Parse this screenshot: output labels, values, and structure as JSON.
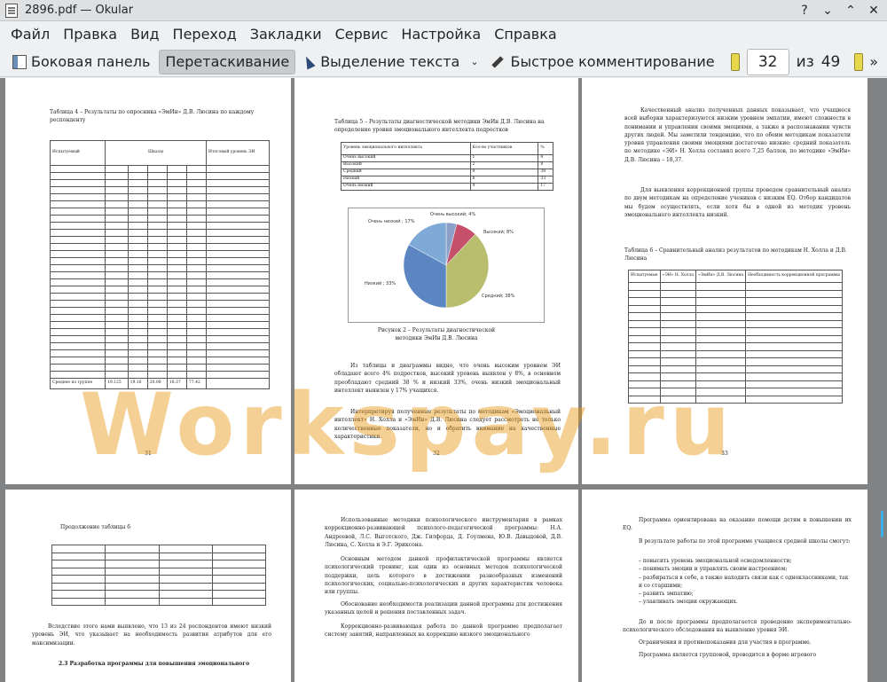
{
  "window": {
    "title": "2896.pdf — Okular"
  },
  "menu": [
    "Файл",
    "Правка",
    "Вид",
    "Переход",
    "Закладки",
    "Сервис",
    "Настройка",
    "Справка"
  ],
  "toolbar": {
    "sidebar": "Боковая панель",
    "drag": "Перетаскивание",
    "select_text": "Выделение текста",
    "quick_comment": "Быстрое комментирование",
    "page_current": "32",
    "of_label": "из",
    "page_total": "49"
  },
  "watermark": "Workspay.ru",
  "pages": {
    "p31": {
      "caption": "Таблица 4 – Результаты по опросника «ЭмИн» Д.В. Люсина по каждому респонденту",
      "header": [
        "Испытуемый",
        "Шкалы",
        "Итоговый уровень ЭИ"
      ],
      "avg_label": "Среднее по группе",
      "avg_values": [
        "19.125",
        "19.16",
        "20.08",
        "18.37",
        "77.42"
      ],
      "num": "31"
    },
    "p32": {
      "caption": "Таблица 5 – Результаты диагностической методики ЭмИн Д.В. Люсина на определение уровня эмоционального интеллекта подростков",
      "col_headers": [
        "Уровень эмоционального интеллекта",
        "Кол-во участников",
        "%"
      ],
      "rows": [
        [
          "Очень высокий",
          "1",
          "4"
        ],
        [
          "Высокий",
          "2",
          "8"
        ],
        [
          "Средний",
          "9",
          "38"
        ],
        [
          "Низкий",
          "8",
          "33"
        ],
        [
          "Очень низкий",
          "4",
          "17"
        ]
      ],
      "pie_labels": [
        "Очень низкий ; 17%",
        "Очень высокий; 4%",
        "Высокий; 8%",
        "Средний; 38%",
        "Низкий ; 33%"
      ],
      "fig_caption": "Рисунок 2 – Результаты диагностической методики ЭмИн Д.В. Люсина",
      "para1": "Из таблицы и диаграммы видно, что очень высоким уровнем ЭИ обладают всего 4% подростков, высокий уровень выявлен у 8%, в основном преобладают средний 38 % и низкий 33%, очень низкий эмоциональный интеллект выявлен у 17% учащихся.",
      "para2": "Интерпретируя полученные результаты по методикам «Эмоциональный интеллект» Н. Холла и «ЭмИн» Д.В. Люсина следует рассмотреть не только количественные показатели, но и обратить внимание на качественные характеристики.",
      "num": "32"
    },
    "p33": {
      "para1": "Качественный анализ полученных данных показывает, что учащиеся всей выборки характеризуются низким уровнем эмпатии, имеют сложности в понимании и управлении своими эмоциями, а также в распознавании чувств других людей. Мы заметили тенденцию, что по обеим методикам показатели уровня управления своими эмоциями достаточно низкие: средний показатель по методике «ЭИ» Н. Холла составил всего 7,25 баллов, по методике «ЭмИн» Д.В. Люсина – 18,37.",
      "para2": "Для выявления коррекционной группы проведем сравнительный анализ по двум методикам на определение учеников с низким EQ. Отбор кандидатов мы будем осуществлять, если хотя бы в одной из методик уровень эмоционального интеллекта низкий.",
      "caption": "Таблица 6 – Сравнительный анализ результатов по методикам Н. Холла и Д.В. Люсина",
      "col_headers": [
        "Испытуемые",
        "«ЭИ» Н. Холла",
        "«ЭмИн» Д.В. Люсина",
        "Необходимость коррекционной программы"
      ],
      "num": "33"
    },
    "p34": {
      "caption": "Продолжение таблицы 6",
      "para": "Вследствие этого нами выявлено, что 13 из 24 респондентов имеют низкий уровень ЭИ, что указывает на необходимость развития атрибутов для его максимизации.",
      "heading": "2.3 Разработка программы для повышения эмоционального"
    },
    "p35": {
      "para1": "Использованные методики психологического инструментария в рамках коррекционно-развивающей психолого-педагогической программы: Н.А. Андреевой, Л.С. Выготского, Дж. Гилфорда, Д. Гоулмена, Ю.В. Давыдовой, Д.В. Люсина, С. Холла и Э.Г. Эриксона.",
      "para2": "Основным методом данной профилактической программы является психологический тренинг, как один из основных методов психологической поддержки, цель которого в достижении разнообразных изменений психологических, социально-психологических и других характеристик человека или группы.",
      "para3": "Обоснование необходимости реализации данной программы для достижения указанных целей и решения поставленных задач.",
      "para4": "Коррекционно-развивающая работа по данной программе предполагает систему занятий, направленных на коррекцию низкого эмоционального"
    },
    "p36": {
      "para1": "Программа ориентирована на оказание помощи детям в повышении их EQ.",
      "para2": "В результате работы по этой программе учащиеся средней школы смогут:",
      "items": [
        "– повысить уровень эмоциональной осведомленности;",
        "– понимать эмоции и управлять своим настроением;",
        "– разбираться в себе, а также находить связи как с одноклассниками, так и со старшими;",
        "– развить эмпатию;",
        "– улавливать эмоции окружающих."
      ],
      "para3": "До и после программы предполагается проведение экспериментально-психологического обследования на выявление уровня ЭИ.",
      "para4": "Ограничения и противопоказания для участия в программе.",
      "para5": "Программа является групповой, проводится в форме игрового"
    }
  },
  "chart_data": {
    "type": "pie",
    "categories": [
      "Очень высокий",
      "Высокий",
      "Средний",
      "Низкий",
      "Очень низкий"
    ],
    "values": [
      4,
      8,
      38,
      33,
      17
    ],
    "colors": [
      "#8aa0c8",
      "#c4506b",
      "#b9bd6e",
      "#5b86c1",
      "#7fa9d6"
    ]
  }
}
